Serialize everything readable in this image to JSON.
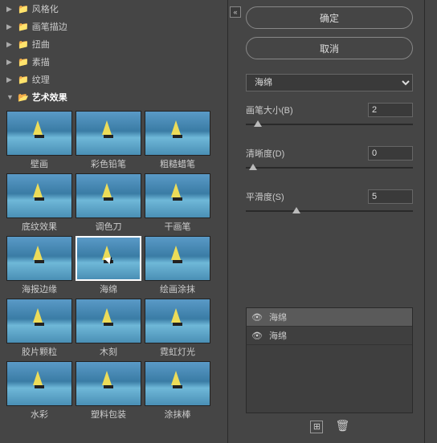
{
  "folders": [
    {
      "label": "风格化",
      "open": false
    },
    {
      "label": "画笔描边",
      "open": false
    },
    {
      "label": "扭曲",
      "open": false
    },
    {
      "label": "素描",
      "open": false
    },
    {
      "label": "纹理",
      "open": false
    },
    {
      "label": "艺术效果",
      "open": true
    }
  ],
  "thumbs": [
    {
      "label": "壁画"
    },
    {
      "label": "彩色铅笔"
    },
    {
      "label": "粗糙蜡笔"
    },
    {
      "label": "底纹效果"
    },
    {
      "label": "调色刀"
    },
    {
      "label": "干画笔"
    },
    {
      "label": "海报边缘"
    },
    {
      "label": "海绵",
      "selected": true
    },
    {
      "label": "绘画涂抹"
    },
    {
      "label": "胶片颗粒"
    },
    {
      "label": "木刻"
    },
    {
      "label": "霓虹灯光"
    },
    {
      "label": "水彩"
    },
    {
      "label": "塑料包装"
    },
    {
      "label": "涂抹棒"
    }
  ],
  "buttons": {
    "ok": "确定",
    "cancel": "取消"
  },
  "filter_select": "海绵",
  "sliders": [
    {
      "label": "画笔大小(B)",
      "value": "2",
      "pos": 5
    },
    {
      "label": "清晰度(D)",
      "value": "0",
      "pos": 2
    },
    {
      "label": "平滑度(S)",
      "value": "5",
      "pos": 28
    }
  ],
  "layers": [
    {
      "name": "海绵",
      "visible": true,
      "selected": true
    },
    {
      "name": "海绵",
      "visible": true,
      "selected": false
    }
  ]
}
